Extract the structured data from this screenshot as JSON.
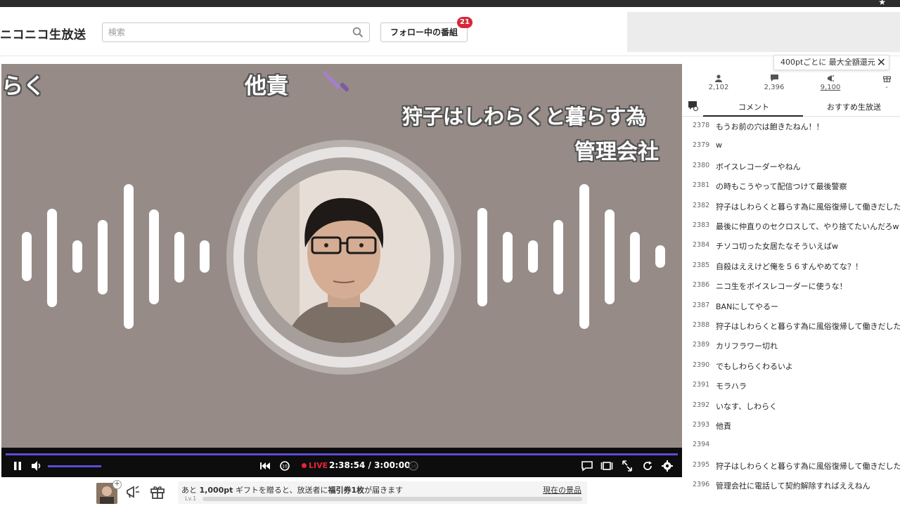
{
  "header": {
    "logo": "ニコニコ生放送",
    "search_placeholder": "検索",
    "follow_label": "フォロー中の番組",
    "follow_badge": "21"
  },
  "video": {
    "captions": [
      "らく",
      "他責",
      "狩子はしわらくと暮らす為",
      "管理会社"
    ],
    "accent_color": "#5b4bd6"
  },
  "controls": {
    "live_label": "LIVE",
    "time": "2:38:54 / 3:00:00"
  },
  "gift": {
    "text_prefix": "あと",
    "points": "1,000pt",
    "text_mid": "ギフトを贈ると、放送者に",
    "ticket": "福引券1枚",
    "text_suffix": "が届きます",
    "level": "Lv.1",
    "link": "現在の景品"
  },
  "sidebar": {
    "tooltip": "400ptごとに 最大全額還元",
    "stats": {
      "viewers": "2,102",
      "comments": "2,396",
      "ad_points": "9,100",
      "gift_points": "-"
    },
    "tabs": [
      "コメント",
      "おすすめ生放送"
    ],
    "comments": [
      {
        "num": "2378",
        "text": "もうお前の穴は飽きたねん！！"
      },
      {
        "num": "2379",
        "text": "w"
      },
      {
        "num": "2380",
        "text": "ボイスレコーダーやねん"
      },
      {
        "num": "2381",
        "text": "の時もこうやって配信つけて最後警察"
      },
      {
        "num": "2382",
        "text": "狩子はしわらくと暮らす為に風俗復帰して働きだしたのに"
      },
      {
        "num": "2383",
        "text": "最後に仲直りのセクロスして、やり捨てたいんだろw"
      },
      {
        "num": "2384",
        "text": "チソコ切った女居たなそういえばw"
      },
      {
        "num": "2385",
        "text": "自殺はええけど俺を５６すんやめてな？！"
      },
      {
        "num": "2386",
        "text": "ニコ生をボイスレコーダーに使うな！"
      },
      {
        "num": "2387",
        "text": "BANにしてやるー"
      },
      {
        "num": "2388",
        "text": "狩子はしわらくと暮らす為に風俗復帰して働きだしたのに"
      },
      {
        "num": "2389",
        "text": "カリフラワー切れ"
      },
      {
        "num": "2390",
        "text": "でもしわらくわるいよ"
      },
      {
        "num": "2391",
        "text": "モラハラ"
      },
      {
        "num": "2392",
        "text": "いなす、しわらく"
      },
      {
        "num": "2393",
        "text": "他責"
      },
      {
        "num": "2394",
        "text": ""
      },
      {
        "num": "2395",
        "text": "狩子はしわらくと暮らす為に風俗復帰して働きだしたのに"
      },
      {
        "num": "2396",
        "text": "管理会社に電話して契約解除すればええねん"
      }
    ]
  }
}
